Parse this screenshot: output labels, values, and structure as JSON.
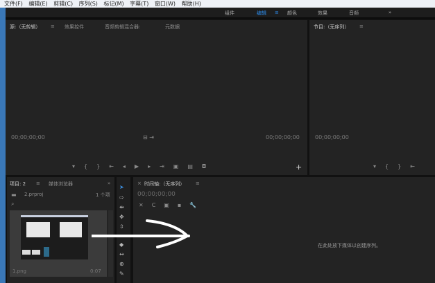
{
  "menu": [
    "文件(F)",
    "编辑(E)",
    "剪辑(C)",
    "序列(S)",
    "标记(M)",
    "字幕(T)",
    "窗口(W)",
    "帮助(H)"
  ],
  "workspaces": {
    "items": [
      "组件",
      "编辑",
      "颜色",
      "效果",
      "音频"
    ],
    "active": "编辑",
    "more": "»",
    "accent": "#2d8ceb"
  },
  "source": {
    "tabs": [
      "源:（无剪辑）",
      "效果控件",
      "音频剪辑混合器:",
      "元数据"
    ],
    "menu": "≡",
    "timecode_left": "00;00;00;00",
    "timecode_right": "00;00;00;00"
  },
  "program": {
    "title": "节目:（无序列）",
    "menu": "≡",
    "timecode": "00;00;00;00"
  },
  "project": {
    "tabs": [
      "项目: 2",
      "媒体浏览器"
    ],
    "menu": "≡",
    "more": "»",
    "file": "2.prproj",
    "count": "1 个项",
    "clip": {
      "name": "1.png",
      "duration": "0:07"
    }
  },
  "timeline": {
    "title": "时间轴:（无序列）",
    "menu": "≡",
    "timecode": "00;00;00;00",
    "hint": "在此处放下媒体以创建序列。"
  }
}
